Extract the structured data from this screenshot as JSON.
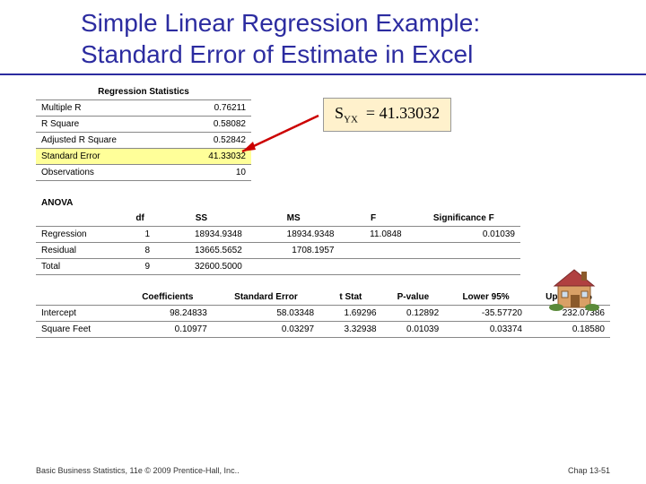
{
  "title_line1": "Simple Linear Regression Example:",
  "title_line2": "Standard Error of Estimate in Excel",
  "stats": {
    "header": "Regression Statistics",
    "rows": [
      {
        "label": "Multiple R",
        "value": "0.76211"
      },
      {
        "label": "R Square",
        "value": "0.58082"
      },
      {
        "label": "Adjusted R Square",
        "value": "0.52842"
      },
      {
        "label": "Standard Error",
        "value": "41.33032",
        "highlight": true
      },
      {
        "label": "Observations",
        "value": "10"
      }
    ]
  },
  "formula": {
    "lhs_sub": "YX",
    "rhs": "41.33032"
  },
  "anova": {
    "title": "ANOVA",
    "headers": [
      "",
      "df",
      "SS",
      "MS",
      "F",
      "Significance F"
    ],
    "rows": [
      {
        "label": "Regression",
        "df": "1",
        "ss": "18934.9348",
        "ms": "18934.9348",
        "f": "11.0848",
        "sigf": "0.01039"
      },
      {
        "label": "Residual",
        "df": "8",
        "ss": "13665.5652",
        "ms": "1708.1957",
        "f": "",
        "sigf": ""
      },
      {
        "label": "Total",
        "df": "9",
        "ss": "32600.5000",
        "ms": "",
        "f": "",
        "sigf": ""
      }
    ]
  },
  "coef": {
    "headers": [
      "",
      "Coefficients",
      "Standard Error",
      "t Stat",
      "P-value",
      "Lower 95%",
      "Upper 95%"
    ],
    "rows": [
      {
        "label": "Intercept",
        "c": "98.24833",
        "se": "58.03348",
        "t": "1.69296",
        "p": "0.12892",
        "lo": "-35.57720",
        "hi": "232.07386"
      },
      {
        "label": "Square Feet",
        "c": "0.10977",
        "se": "0.03297",
        "t": "3.32938",
        "p": "0.01039",
        "lo": "0.03374",
        "hi": "0.18580"
      }
    ]
  },
  "footer_left": "Basic Business Statistics, 11e © 2009 Prentice-Hall, Inc..",
  "footer_right": "Chap 13-51"
}
